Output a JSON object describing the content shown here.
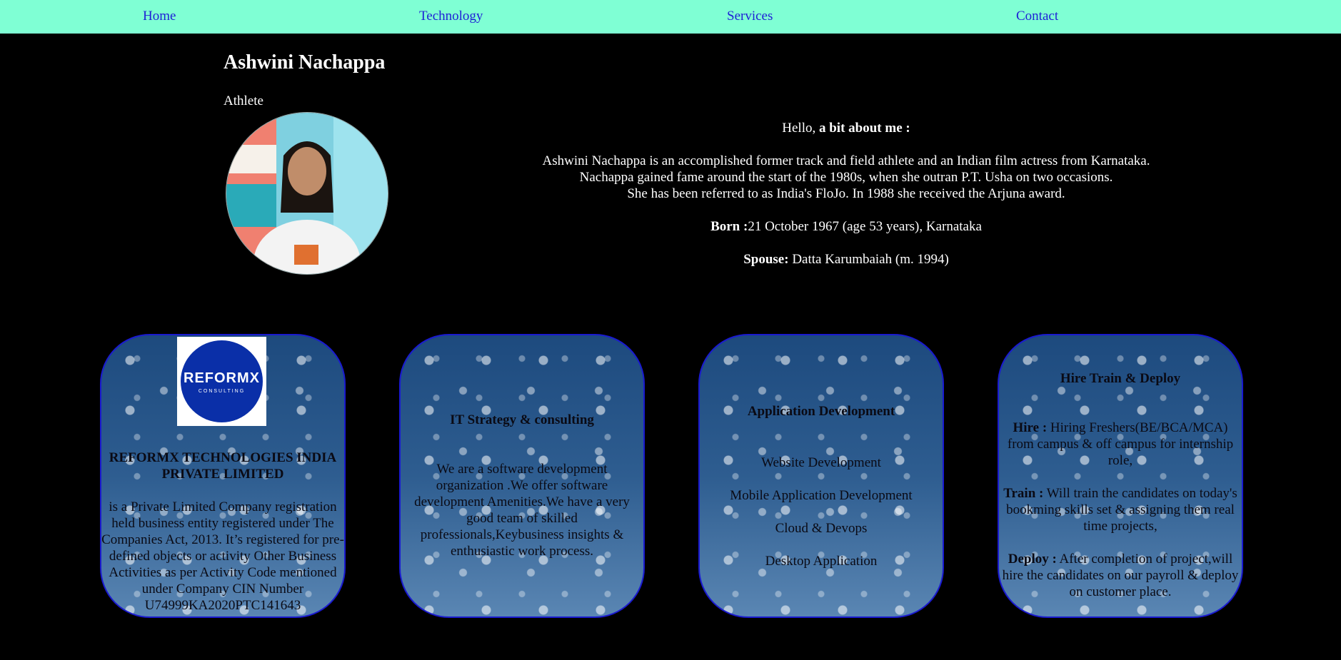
{
  "nav": {
    "items": [
      {
        "label": "Home"
      },
      {
        "label": "Technology"
      },
      {
        "label": "Services"
      },
      {
        "label": "Contact"
      }
    ]
  },
  "profile": {
    "name": "Ashwini Nachappa",
    "role": "Athlete",
    "greeting_prefix": "Hello, ",
    "greeting_bold": "a bit about me :",
    "bio_lines": [
      "Ashwini Nachappa is an accomplished former track and field athlete and an Indian film actress from Karnataka.",
      "Nachappa gained fame around the start of the 1980s, when she outran P.T. Usha on two occasions.",
      "She has been referred to as India's FloJo. In 1988 she received the Arjuna award."
    ],
    "born_label": "Born :",
    "born_value": "21 October 1967 (age 53 years), Karnataka",
    "spouse_label": "Spouse:",
    "spouse_value": " Datta Karumbaiah (m. 1994)"
  },
  "cards": {
    "company": {
      "logo_text": "REFORMX",
      "logo_sub": "CONSULTING",
      "title": "REFORMX TECHNOLOGIES INDIA PRIVATE LIMITED",
      "text": "is a Private Limited Company registration held business entity registered under The Companies Act, 2013. It’s registered for pre-defined objects or activity Other Business Activities as per Activity Code mentioned under Company CIN Number U74999KA2020PTC141643"
    },
    "strategy": {
      "title": "IT Strategy & consulting",
      "text": "We are a software development organization .We offer software development Amenities.We have a very good team of skilled professionals,Keybusiness insights & enthusiastic work process."
    },
    "appdev": {
      "title": "Application Development",
      "items": [
        "Website Development",
        "Mobile Application Development",
        "Cloud & Devops",
        "Desktop Application"
      ]
    },
    "hire": {
      "title": "Hire Train & Deploy",
      "hire_label": "Hire :",
      "hire_text": " Hiring Freshers(BE/BCA/MCA) from campus & off campus for internship role,",
      "train_label": "Train :",
      "train_text": " Will train the candidates on today's bookming skills set & assigning them real time projects,",
      "deploy_label": "Deploy :",
      "deploy_text": " After completion of project,will hire the candidates on our payroll & deploy on customer place."
    }
  }
}
